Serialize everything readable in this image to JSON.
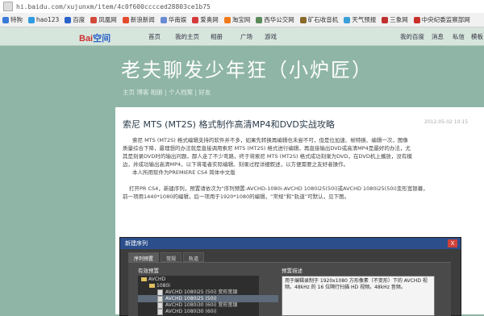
{
  "address": {
    "url": "hi.baidu.com/xujunxm/item/4c0f600cccced28803ce1b75"
  },
  "bookmarks": [
    {
      "label": "特狗",
      "color": "#3b7ad8"
    },
    {
      "label": "hao123",
      "color": "#2f9be0"
    },
    {
      "label": "百度",
      "color": "#2b63c8"
    },
    {
      "label": "凤凰网",
      "color": "#d24a3c"
    },
    {
      "label": "新浪新闻",
      "color": "#e44b2c"
    },
    {
      "label": "华南娱",
      "color": "#6a8bd3"
    },
    {
      "label": "爱奥网",
      "color": "#d43a3a"
    },
    {
      "label": "淘宝网",
      "color": "#f07a1a"
    },
    {
      "label": "西华公交网",
      "color": "#5a8a5a"
    },
    {
      "label": "矿石收音机",
      "color": "#8a6a2a"
    },
    {
      "label": "天气预报",
      "color": "#3aa0d8"
    },
    {
      "label": "三象网",
      "color": "#c03030"
    },
    {
      "label": "中央纪委监察部网",
      "color": "#c8302a"
    }
  ],
  "nav": {
    "logo": "Bai",
    "logo_du": "空间",
    "items": [
      "首页",
      "我的主页",
      "相册",
      "广场",
      "游戏"
    ],
    "right": [
      "我的百度",
      "消息",
      "私信",
      "模板"
    ]
  },
  "banner": {
    "title": "老夫聊发少年狂（小炉匠）",
    "subtitle": "主页 博客 相册 | 个人档案 | 好友"
  },
  "article": {
    "title": "索尼 MTS (MT2S) 格式制作高清MP4和DVD实战攻略",
    "date": "2012-05-02 10:15",
    "lines": [
      "索尼 MTS (MT2S) 格式编辑支持的软件并不多，如果先转换再编辑也未尝不可，但是位加速、帧特换、编辑一次，图像",
      "质量综合下降，最理想的办法就是直接调用索尼 MTS (MT2S) 格式进行编辑，再直接输出DVD或高清MP4是最好的办法，尤",
      "其是刻录DVD时的输出问题，鄙人走了不少弯路，终于将索尼 MTS (MT2S) 格式成功刻录为DVD，在DVD机上播放，没有模",
      "边，并成功输出高清MP4，以下将笔者实际编辑、刻录过程详细叙述，以方便需要之友好者操作。",
      "本人所用软件为PREMIERE CS4 简体中文版",
      "打开PR CS4，新建序列，预置请依次为“序列预置-AVCHD-1080i-AVCHD 1080i25(50i)或AVCHD 1080i25(50i)变形宽银幕，",
      "前一项用1440*1080的编辑，后一项用于1920*1080的编辑，“常规”和“轨道”可默认，见下图。"
    ]
  },
  "dialog": {
    "title": "新建序列",
    "close": "X",
    "tabs": [
      "序列预置",
      "常规",
      "轨道"
    ],
    "presets_label": "有效预置",
    "desc_label": "预置描述",
    "tree": [
      {
        "label": "AVCHD",
        "type": "folder",
        "indent": 0
      },
      {
        "label": "1080i",
        "type": "folder",
        "indent": 1
      },
      {
        "label": "AVCHD 1080i25 (50i) 变形宽银",
        "type": "file",
        "indent": 2,
        "selected": false
      },
      {
        "label": "AVCHD 1080i25 (50i)",
        "type": "file",
        "indent": 2,
        "selected": true
      },
      {
        "label": "AVCHD 1080i30 (60i) 变形宽银",
        "type": "file",
        "indent": 2,
        "selected": false
      },
      {
        "label": "AVCHD 1080i30 (60i)",
        "type": "file",
        "indent": 2,
        "selected": false
      }
    ],
    "description": "用于编辑录制于 1920x1080 方形像素（不变形）下的 AVCHD 视频。48kHz 的 16 位隔行扫描 HD 视频。48kHz 音频。"
  }
}
